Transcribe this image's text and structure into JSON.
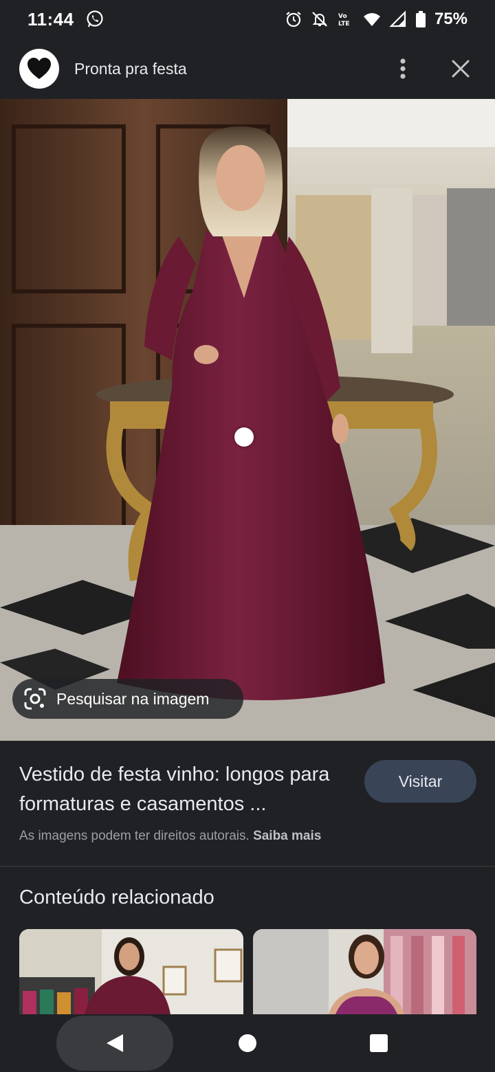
{
  "status_bar": {
    "time": "11:44",
    "battery": "75%",
    "icons": [
      "whatsapp-icon",
      "alarm-icon",
      "notifications-off-icon",
      "volte-icon",
      "wifi-icon",
      "signal-icon",
      "battery-icon"
    ]
  },
  "app_bar": {
    "title": "Pronta pra festa",
    "logo_icon": "heart-icon",
    "more_icon": "more-vert-icon",
    "close_icon": "close-icon"
  },
  "hero": {
    "lens_label": "Pesquisar na imagem",
    "lens_icon": "google-lens-icon"
  },
  "result": {
    "title": "Vestido de festa vinho: longos para formaturas e casamentos ...",
    "visit_label": "Visitar",
    "copyright_text": "As imagens podem ter direitos autorais.",
    "learn_more": "Saiba mais"
  },
  "related": {
    "title": "Conteúdo relacionado"
  },
  "nav": {
    "back_icon": "back-icon",
    "home_icon": "home-icon",
    "recents_icon": "recents-icon"
  },
  "colors": {
    "background": "#202124",
    "visit_button": "#394457",
    "dress": "#6e1a33"
  }
}
